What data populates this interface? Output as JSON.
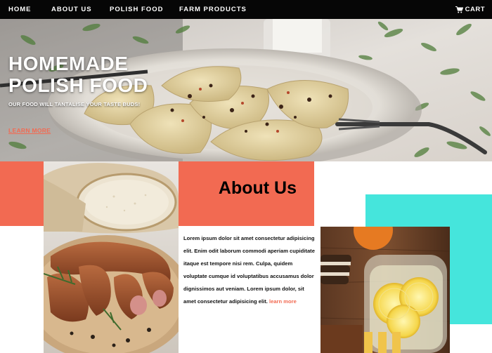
{
  "nav": {
    "items": [
      "HOME",
      "ABOUT US",
      "POLISH FOOD",
      "FARM PRODUCTS"
    ],
    "cart_label": "CART",
    "cart_icon": "cart-icon"
  },
  "hero": {
    "title_line1": "HOMEMADE",
    "title_line2": "POLISH FOOD",
    "subtitle": "OUR FOOD WILL TANTALISE YOUR TASTE BUDS!",
    "link": "LEARN MORE",
    "image": "pierogi-plate-photo"
  },
  "about": {
    "title": "About Us",
    "body": "Lorem ipsum dolor sit amet consectetur adipisicing elit. Enim odit laborum commodi aperiam cupiditate itaque est tempore nisi rem. Culpa, quidem voluptate cumque id voluptatibus accusamus dolor dignissimos aut veniam. Lorem ipsum dolor, sit amet consectetur adipisicing elit.",
    "more_link": "learn more"
  },
  "images": {
    "bread": "bread-and-sausage-photo",
    "lemon": "lemon-water-photo"
  },
  "colors": {
    "nav_bg": "#060606",
    "accent_coral": "#f26a52",
    "accent_cyan": "#45e5dc"
  }
}
